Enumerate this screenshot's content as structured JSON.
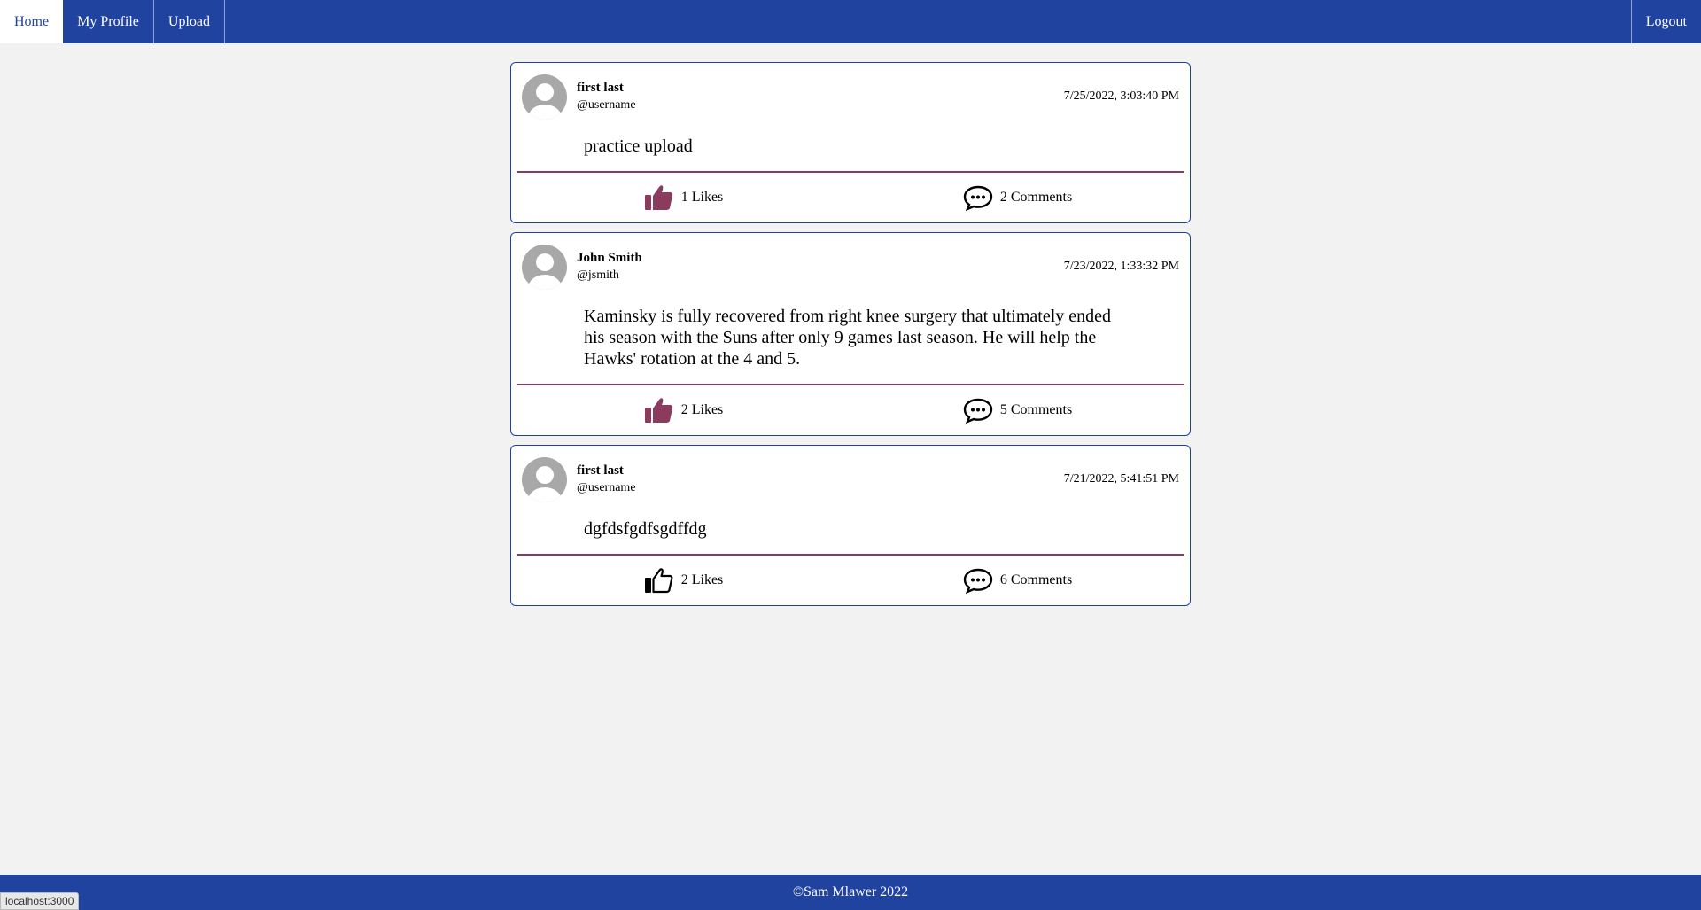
{
  "nav": {
    "home": "Home",
    "profile": "My Profile",
    "upload": "Upload",
    "logout": "Logout"
  },
  "posts": [
    {
      "name": "first last",
      "handle": "@username",
      "date": "7/25/2022, 3:03:40 PM",
      "text": "practice upload",
      "likes": "1 Likes",
      "comments": "2 Comments",
      "liked": true
    },
    {
      "name": "John Smith",
      "handle": "@jsmith",
      "date": "7/23/2022, 1:33:32 PM",
      "text": "Kaminsky is fully recovered from right knee surgery that ultimately ended his season with the Suns after only 9 games last season. He will help the Hawks' rotation at the 4 and 5.",
      "likes": "2 Likes",
      "comments": "5 Comments",
      "liked": true
    },
    {
      "name": "first last",
      "handle": "@username",
      "date": "7/21/2022, 5:41:51 PM",
      "text": "dgfdsfgdfsgdffdg",
      "likes": "2 Likes",
      "comments": "6 Comments",
      "liked": false
    }
  ],
  "footer": "©Sam Mlawer 2022",
  "status_url": "localhost:3000",
  "colors": {
    "nav": "#2143a0",
    "like_active": "#8a3b5e",
    "divider": "#8a3b5e"
  }
}
